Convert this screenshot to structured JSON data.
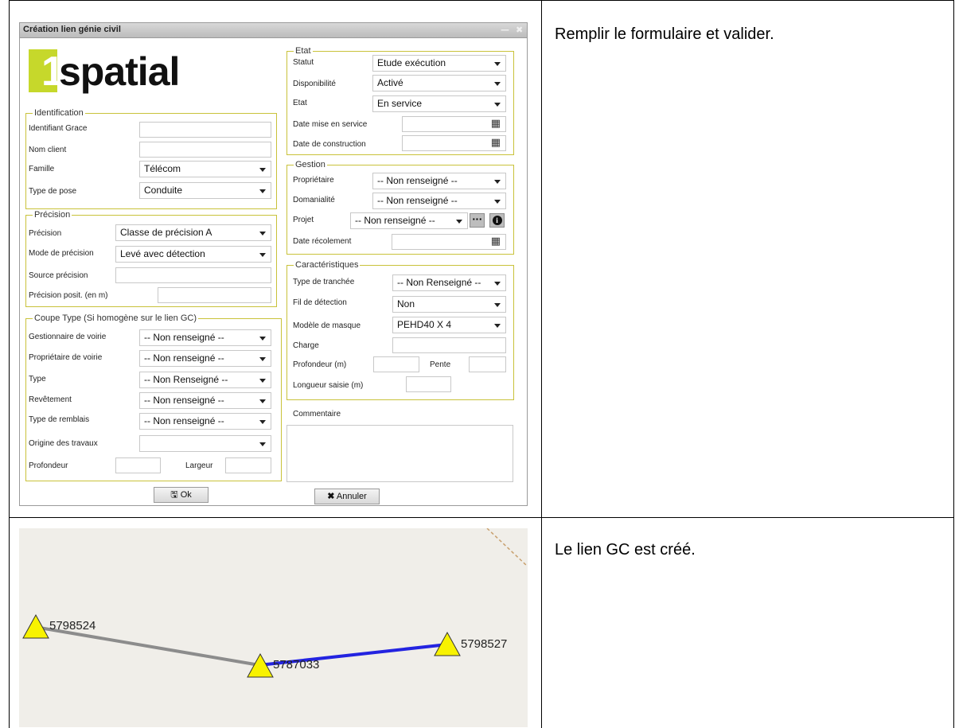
{
  "instructions": {
    "row1": "Remplir le formulaire et valider.",
    "row2": "Le lien GC est créé."
  },
  "dialog": {
    "title": "Création lien génie civil",
    "logo": {
      "digit": "1",
      "word": "spatial",
      "color": "#c6d82b"
    },
    "identification": {
      "legend": "Identification",
      "fields": [
        {
          "label": "Identifiant Grace",
          "value": ""
        },
        {
          "label": "Nom client",
          "value": ""
        },
        {
          "label": "Famille",
          "value": "Télécom"
        },
        {
          "label": "Type de pose",
          "value": "Conduite"
        }
      ]
    },
    "precision": {
      "legend": "Précision",
      "fields": [
        {
          "label": "Précision",
          "value": "Classe de précision A"
        },
        {
          "label": "Mode de précision",
          "value": "Levé avec détection"
        },
        {
          "label": "Source précision",
          "value": ""
        },
        {
          "label": "Précision posit. (en m)",
          "value": ""
        }
      ]
    },
    "coupe": {
      "legend": "Coupe Type (Si homogène sur le lien GC)",
      "fields": [
        {
          "label": "Gestionnaire de voirie",
          "value": "-- Non renseigné --"
        },
        {
          "label": "Propriétaire de voirie",
          "value": "-- Non renseigné --"
        },
        {
          "label": "Type",
          "value": "-- Non Renseigné --"
        },
        {
          "label": "Revêtement",
          "value": "-- Non renseigné --"
        },
        {
          "label": "Type de remblais",
          "value": "-- Non renseigné --"
        },
        {
          "label": "Origine des travaux",
          "value": ""
        }
      ],
      "profondeur_label": "Profondeur",
      "largeur_label": "Largeur"
    },
    "etat": {
      "legend": "Etat",
      "fields": [
        {
          "label": "Statut",
          "value": "Etude exécution"
        },
        {
          "label": "Disponibilité",
          "value": "Activé"
        },
        {
          "label": "Etat",
          "value": "En service"
        },
        {
          "label": "Date mise en service",
          "value": ""
        },
        {
          "label": "Date de construction",
          "value": ""
        }
      ]
    },
    "gestion": {
      "legend": "Gestion",
      "fields": [
        {
          "label": "Propriétaire",
          "value": "-- Non renseigné --"
        },
        {
          "label": "Domanialité",
          "value": "-- Non renseigné --"
        },
        {
          "label": "Projet",
          "value": "-- Non renseigné --"
        },
        {
          "label": "Date récolement",
          "value": ""
        }
      ],
      "more_glyph": "···",
      "info_glyph": "i"
    },
    "caracteristiques": {
      "legend": "Caractéristiques",
      "fields": [
        {
          "label": "Type de tranchée",
          "value": "-- Non Renseigné --"
        },
        {
          "label": "Fil de détection",
          "value": "Non"
        },
        {
          "label": "Modèle de masque",
          "value": "PEHD40 X 4"
        },
        {
          "label": "Charge",
          "value": ""
        }
      ],
      "profondeur_label": "Profondeur (m)",
      "pente_label": "Pente",
      "longueur_label": "Longueur saisie (m)"
    },
    "commentaire_label": "Commentaire",
    "ok_label": "Ok",
    "annuler_label": "Annuler"
  },
  "map": {
    "nodes": [
      {
        "id": "5798524"
      },
      {
        "id": "5787033"
      },
      {
        "id": "5798527"
      }
    ],
    "existing_link_color": "#8c8c8c",
    "new_link_color": "#2323e0",
    "node_fill": "#f8f200"
  }
}
